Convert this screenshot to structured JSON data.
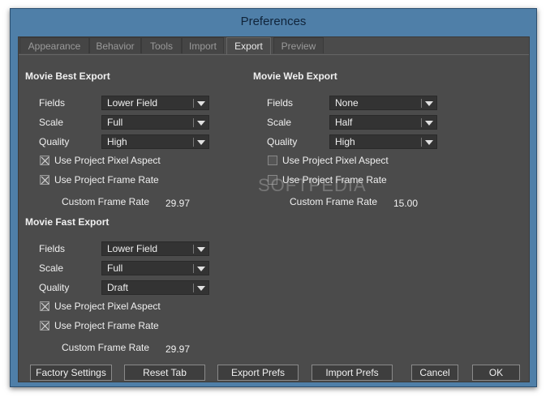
{
  "window": {
    "title": "Preferences"
  },
  "tabs": [
    {
      "label": "Appearance",
      "active": false
    },
    {
      "label": "Behavior",
      "active": false
    },
    {
      "label": "Tools",
      "active": false
    },
    {
      "label": "Import",
      "active": false
    },
    {
      "label": "Export",
      "active": true
    },
    {
      "label": "Preview",
      "active": false
    }
  ],
  "best": {
    "heading": "Movie Best Export",
    "fields_label": "Fields",
    "fields_value": "Lower Field",
    "scale_label": "Scale",
    "scale_value": "Full",
    "quality_label": "Quality",
    "quality_value": "High",
    "pixel_aspect_label": "Use Project Pixel Aspect",
    "pixel_aspect_checked": true,
    "frame_rate_label": "Use Project Frame Rate",
    "frame_rate_checked": true,
    "custom_rate_label": "Custom Frame Rate",
    "custom_rate_value": "29.97"
  },
  "web": {
    "heading": "Movie Web Export",
    "fields_label": "Fields",
    "fields_value": "None",
    "scale_label": "Scale",
    "scale_value": "Half",
    "quality_label": "Quality",
    "quality_value": "High",
    "pixel_aspect_label": "Use Project Pixel Aspect",
    "pixel_aspect_checked": false,
    "frame_rate_label": "Use Project Frame Rate",
    "frame_rate_checked": false,
    "custom_rate_label": "Custom Frame Rate",
    "custom_rate_value": "15.00"
  },
  "fast": {
    "heading": "Movie Fast Export",
    "fields_label": "Fields",
    "fields_value": "Lower Field",
    "scale_label": "Scale",
    "scale_value": "Full",
    "quality_label": "Quality",
    "quality_value": "Draft",
    "pixel_aspect_label": "Use Project Pixel Aspect",
    "pixel_aspect_checked": true,
    "frame_rate_label": "Use Project Frame Rate",
    "frame_rate_checked": true,
    "custom_rate_label": "Custom Frame Rate",
    "custom_rate_value": "29.97"
  },
  "buttons": {
    "factory": "Factory Settings",
    "reset": "Reset Tab",
    "export": "Export Prefs",
    "import": "Import Prefs",
    "cancel": "Cancel",
    "ok": "OK"
  },
  "watermark": "SOFTPEDIA"
}
